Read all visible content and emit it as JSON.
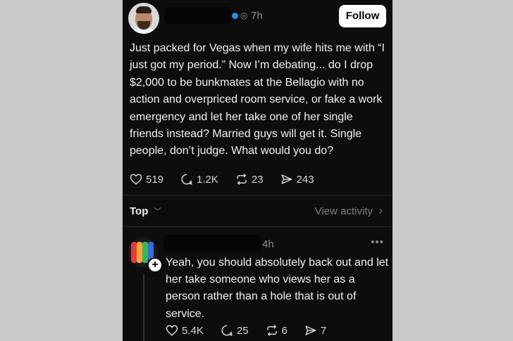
{
  "post": {
    "time": "7h",
    "follow_label": "Follow",
    "text": "Just packed for Vegas when my wife hits me with “I just got my period.” Now I’m debating... do I drop $2,000 to be bunkmates at the Bellagio with no action and overpriced room service, or fake a work emergency and let her take one of her single friends instead? Married guys will get it. Single people, don’t judge. What would you do?",
    "likes": "519",
    "comments": "1.2K",
    "reposts": "23",
    "shares": "243"
  },
  "sort": {
    "label": "Top",
    "view_activity": "View activity"
  },
  "reply": {
    "time": "4h",
    "text": "Yeah, you should absolutely back out and let her take someone who views her as a person rather than a hole that is out of service.",
    "likes": "5.4K",
    "comments": "25",
    "reposts": "6",
    "shares": "7"
  },
  "colors": {
    "background": "#0d0d0d",
    "text": "#f2f2f2",
    "muted": "#8a8a8a",
    "verified": "#1d8fe8"
  },
  "icons": [
    "heart-icon",
    "comment-icon",
    "repost-icon",
    "share-icon",
    "chevron-down-icon",
    "chevron-right-icon",
    "more-icon",
    "plus-icon"
  ]
}
